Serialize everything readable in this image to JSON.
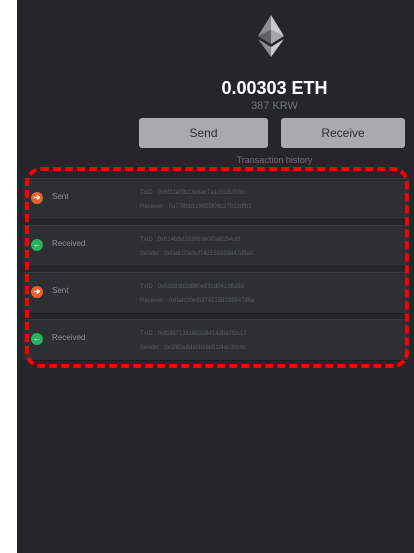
{
  "wallet": {
    "balance": "0.00303 ETH",
    "fiat": "387 KRW"
  },
  "actions": {
    "send_label": "Send",
    "receive_label": "Receive"
  },
  "history": {
    "title": "Transaction history",
    "transactions": [
      {
        "type": "Sent",
        "direction": "sent",
        "line1": "TxID : 0x6f32ef3b13e6ac7a1c018cf06b",
        "line2": "Receiver : 0a778bb1c9825f09c27023dfb3"
      },
      {
        "type": "Received",
        "direction": "received",
        "line1": "TxID : 0x614b8d293ff8de0f0a8154c8f",
        "line2": "Sender : 0xfadc00e9cf742158333847d6a0"
      },
      {
        "type": "Sent",
        "direction": "sent",
        "line1": "TxID : 0x0d383b2d880e83cd04138a5d",
        "line2": "Receiver : 0xfadc00e9cf742158333847d6a"
      },
      {
        "type": "Received",
        "direction": "received",
        "line1": "TxID : 0xfb36713116b326414dba7f2c13",
        "line2": "Sender : 0x2f82a8dacb1bb51f4ac3bc8c"
      }
    ]
  },
  "colors": {
    "sent": "#e8642a",
    "received": "#27b25c",
    "highlight": "#ff0000"
  },
  "icons": {
    "logo": "ethereum-icon",
    "sent": "arrow-right-icon",
    "received": "arrow-left-icon"
  }
}
